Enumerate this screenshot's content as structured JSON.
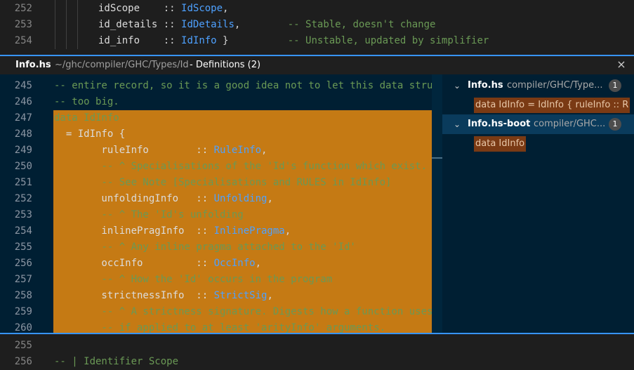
{
  "top_editor": {
    "lines": [
      {
        "num": "252",
        "tokens": [
          {
            "t": "idScope",
            "c": "ident"
          },
          {
            "t": "    :: ",
            "c": "punct"
          },
          {
            "t": "IdScope",
            "c": "type"
          },
          {
            "t": ",",
            "c": "punct"
          }
        ]
      },
      {
        "num": "253",
        "tokens": [
          {
            "t": "id_details",
            "c": "ident"
          },
          {
            "t": " :: ",
            "c": "punct"
          },
          {
            "t": "IdDetails",
            "c": "type"
          },
          {
            "t": ",",
            "c": "punct"
          },
          {
            "t": "        -- Stable, doesn't change",
            "c": "comment"
          }
        ]
      },
      {
        "num": "254",
        "tokens": [
          {
            "t": "id_info",
            "c": "ident"
          },
          {
            "t": "    :: ",
            "c": "punct"
          },
          {
            "t": "IdInfo",
            "c": "type"
          },
          {
            "t": " }",
            "c": "punct"
          },
          {
            "t": "          -- Unstable, updated by simplifier",
            "c": "comment"
          }
        ]
      }
    ]
  },
  "peek": {
    "file_name": "Info.hs",
    "file_path": "~/ghc/compiler/GHC/Types/Id",
    "title": "- Definitions (2)",
    "close_icon": "×",
    "lines": [
      {
        "num": "245",
        "hl": false,
        "tokens": [
          {
            "t": "-- entire record, so it is a good idea not to let this data structure",
            "c": "comment"
          }
        ]
      },
      {
        "num": "246",
        "hl": false,
        "tokens": [
          {
            "t": "-- too big.",
            "c": "comment"
          }
        ]
      },
      {
        "num": "247",
        "hl": true,
        "tokens": [
          {
            "t": "data IdInfo",
            "c": "comment"
          }
        ]
      },
      {
        "num": "248",
        "hl": true,
        "tokens": [
          {
            "t": "  = IdInfo {",
            "c": "ident"
          }
        ]
      },
      {
        "num": "249",
        "hl": true,
        "tokens": [
          {
            "t": "        ruleInfo        :: ",
            "c": "ident"
          },
          {
            "t": "RuleInfo",
            "c": "type"
          },
          {
            "t": ",",
            "c": "punct"
          }
        ]
      },
      {
        "num": "250",
        "hl": true,
        "tokens": [
          {
            "t": "        -- ^ Specialisations of the 'Id's function which exist.",
            "c": "comment"
          }
        ]
      },
      {
        "num": "251",
        "hl": true,
        "tokens": [
          {
            "t": "        -- See Note [Specialisations and RULES in IdInfo]",
            "c": "comment"
          }
        ]
      },
      {
        "num": "252",
        "hl": true,
        "tokens": [
          {
            "t": "        unfoldingInfo   :: ",
            "c": "ident"
          },
          {
            "t": "Unfolding",
            "c": "type"
          },
          {
            "t": ",",
            "c": "punct"
          }
        ]
      },
      {
        "num": "253",
        "hl": true,
        "tokens": [
          {
            "t": "        -- ^ The 'Id's unfolding",
            "c": "comment"
          }
        ]
      },
      {
        "num": "254",
        "hl": true,
        "tokens": [
          {
            "t": "        inlinePragInfo  :: ",
            "c": "ident"
          },
          {
            "t": "InlinePragma",
            "c": "type"
          },
          {
            "t": ",",
            "c": "punct"
          }
        ]
      },
      {
        "num": "255",
        "hl": true,
        "tokens": [
          {
            "t": "        -- ^ Any inline pragma attached to the 'Id'",
            "c": "comment"
          }
        ]
      },
      {
        "num": "256",
        "hl": true,
        "tokens": [
          {
            "t": "        occInfo         :: ",
            "c": "ident"
          },
          {
            "t": "OccInfo",
            "c": "type"
          },
          {
            "t": ",",
            "c": "punct"
          }
        ]
      },
      {
        "num": "257",
        "hl": true,
        "tokens": [
          {
            "t": "        -- ^ How the 'Id' occurs in the program",
            "c": "comment"
          }
        ]
      },
      {
        "num": "258",
        "hl": true,
        "tokens": [
          {
            "t": "        strictnessInfo  :: ",
            "c": "ident"
          },
          {
            "t": "StrictSig",
            "c": "type"
          },
          {
            "t": ",",
            "c": "punct"
          }
        ]
      },
      {
        "num": "259",
        "hl": true,
        "tokens": [
          {
            "t": "        -- ^ A strictness signature. Digests how a function uses its",
            "c": "comment"
          }
        ]
      },
      {
        "num": "260",
        "hl": true,
        "tokens": [
          {
            "t": "        -- if applied to at least 'arityInfo' arguments.",
            "c": "comment"
          }
        ]
      }
    ],
    "tree": [
      {
        "file": "Info.hs",
        "path": "compiler/GHC/Type...",
        "count": "1",
        "selected": false,
        "match": "data IdInfo = IdInfo { ruleInfo :: R"
      },
      {
        "file": "Info.hs-boot",
        "path": "compiler/GHC...",
        "count": "1",
        "selected": true,
        "match": "data IdInfo"
      }
    ]
  },
  "bottom_editor": {
    "lines": [
      {
        "num": "255",
        "tokens": []
      },
      {
        "num": "256",
        "tokens": [
          {
            "t": "-- | Identifier Scope",
            "c": "comment"
          }
        ]
      }
    ]
  }
}
